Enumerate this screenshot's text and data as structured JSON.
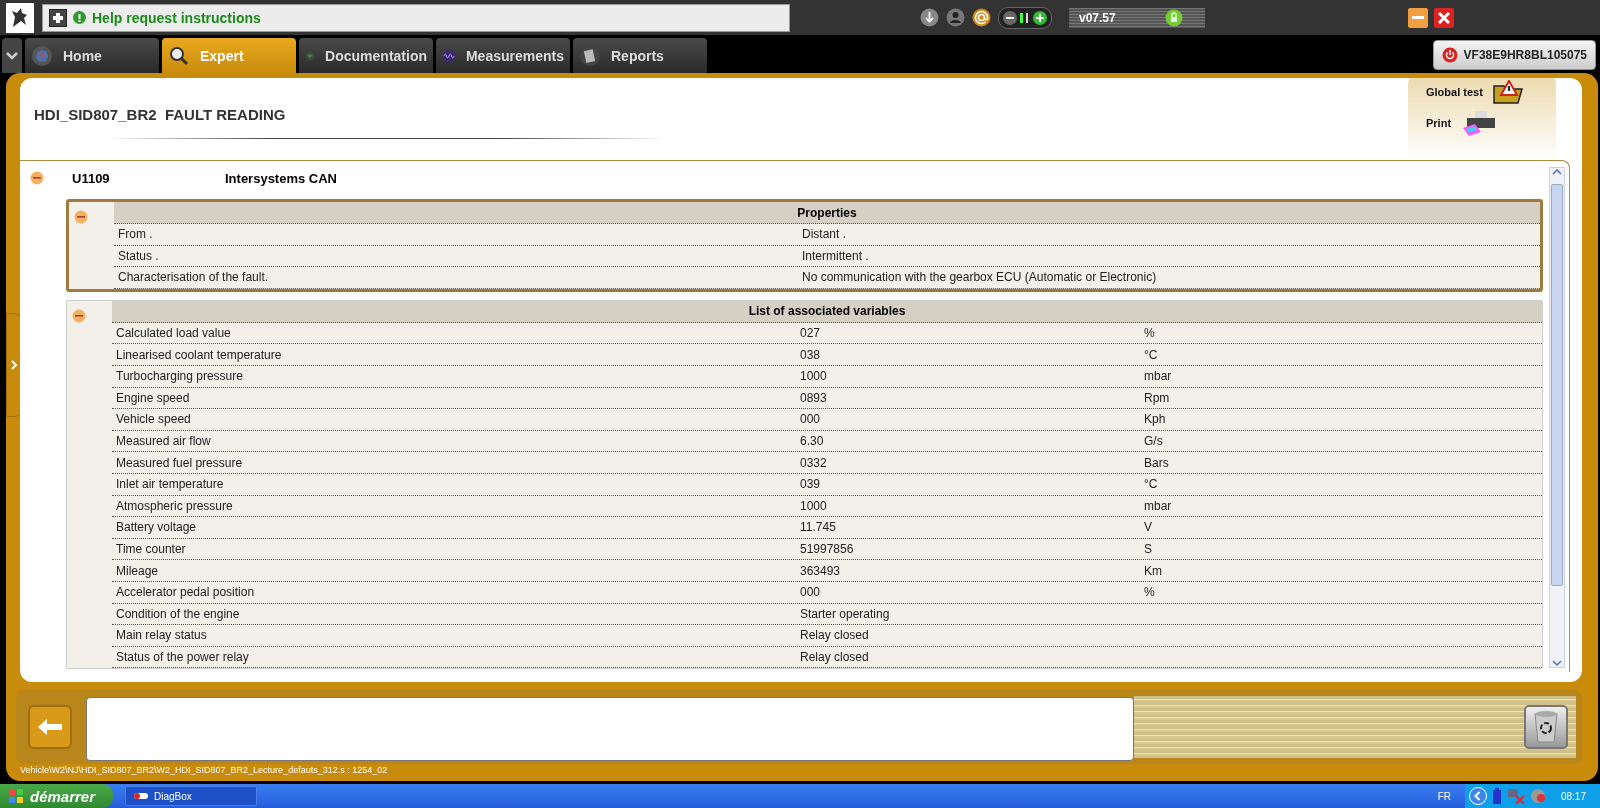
{
  "top_bar": {
    "help_text": "Help request instructions",
    "version": "v07.57"
  },
  "tabs": [
    {
      "label": "Home",
      "kind": "globe",
      "selected": false
    },
    {
      "label": "Expert",
      "kind": "magnifier",
      "selected": true
    },
    {
      "label": "Documentation",
      "kind": "book",
      "selected": false
    },
    {
      "label": "Measurements",
      "kind": "wave",
      "selected": false
    },
    {
      "label": "Reports",
      "kind": "papers",
      "selected": false
    }
  ],
  "vehicle_id": "VF38E9HR8BL105075",
  "title": "HDI_SID807_BR2  FAULT READING",
  "actions": [
    {
      "label": "Global test",
      "kind": "warning"
    },
    {
      "label": "Print",
      "kind": "printer"
    }
  ],
  "fault": {
    "code": "U1109",
    "name": "Intersystems CAN",
    "expanded": true,
    "properties": {
      "title": "Properties",
      "expanded": true,
      "rows": [
        {
          "label": "From .",
          "value": "Distant ."
        },
        {
          "label": "Status .",
          "value": "Intermittent ."
        },
        {
          "label": "Characterisation of the fault.",
          "value": "No communication with the gearbox ECU (Automatic or Electronic)"
        }
      ]
    },
    "variables": {
      "title": "List of associated variables",
      "expanded": true,
      "rows": [
        {
          "name": "Calculated load value",
          "value": "027",
          "unit": "%"
        },
        {
          "name": "Linearised coolant temperature",
          "value": "038",
          "unit": "°C"
        },
        {
          "name": "Turbocharging pressure",
          "value": "1000",
          "unit": "mbar"
        },
        {
          "name": "Engine speed",
          "value": "0893",
          "unit": "Rpm"
        },
        {
          "name": "Vehicle speed",
          "value": "000",
          "unit": "Kph"
        },
        {
          "name": "Measured air flow",
          "value": "6.30",
          "unit": "G/s"
        },
        {
          "name": "Measured fuel pressure",
          "value": "0332",
          "unit": "Bars"
        },
        {
          "name": "Inlet air temperature",
          "value": "039",
          "unit": "°C"
        },
        {
          "name": "Atmospheric pressure",
          "value": "1000",
          "unit": "mbar"
        },
        {
          "name": "Battery voltage",
          "value": "11.745",
          "unit": "V"
        },
        {
          "name": "Time counter",
          "value": "51997856",
          "unit": "S"
        },
        {
          "name": "Mileage",
          "value": "363493",
          "unit": "Km"
        },
        {
          "name": "Accelerator pedal position",
          "value": "000",
          "unit": "%"
        },
        {
          "name": "Condition of the engine",
          "value": "Starter operating"
        },
        {
          "name": "Main relay status",
          "value": "Relay closed"
        },
        {
          "name": "Status of the power relay",
          "value": "Relay closed"
        }
      ]
    }
  },
  "path": "Vehicle\\W2\\NJ\\HDI_SID807_BR2\\W2_HDI_SID807_BR2_Lecture_defauts_312.s : 1254_02",
  "taskbar": {
    "start": "démarrer",
    "task": "DiagBox",
    "language": "FR",
    "clock": "08:17"
  }
}
